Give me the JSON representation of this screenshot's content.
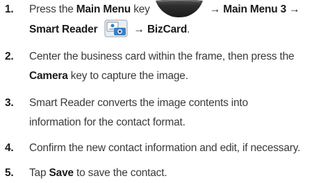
{
  "steps": [
    {
      "number": "1.",
      "line1": {
        "pre": "Press the",
        "key1": "Main Menu",
        "mid": "key",
        "arrow1": "→",
        "key2": "Main Menu 3",
        "arrow2": "→"
      },
      "line2": {
        "key": "Smart Reader",
        "arrow": "→",
        "key2": "BizCard",
        "end": "."
      }
    },
    {
      "number": "2.",
      "line1": "Center the business card within the frame, then press the",
      "line2": {
        "key": "Camera",
        "post": "key to capture the image."
      }
    },
    {
      "number": "3.",
      "line1": "Smart Reader converts the image contents into",
      "line2": "information for the contact format."
    },
    {
      "number": "4.",
      "line1": "Confirm the new contact information and edit, if necessary."
    },
    {
      "number": "5.",
      "line1": {
        "pre": "Tap",
        "key": "Save",
        "post": "to save the contact."
      }
    }
  ],
  "icons": {
    "main_menu_key": "main-menu-key-icon",
    "smart_reader": "smart-reader-icon"
  },
  "colors": {
    "text": "#3a3a3a",
    "bold": "#1a1a1a",
    "key_dark": "#2b2b2b",
    "icon_blue": "#3c7fc4"
  }
}
